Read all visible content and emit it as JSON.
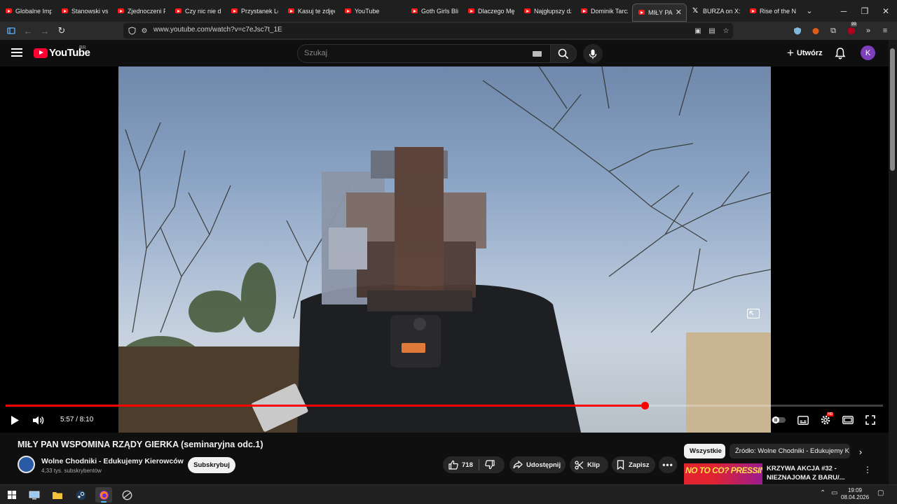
{
  "browser": {
    "tabs": [
      {
        "label": "Globalne Impe",
        "icon": "youtube-icon"
      },
      {
        "label": "Stanowski vs W",
        "icon": "youtube-icon"
      },
      {
        "label": "Zjednoczeni Pr",
        "icon": "youtube-icon"
      },
      {
        "label": "Czy nic nie dzi",
        "icon": "youtube-icon"
      },
      {
        "label": "Przystanek Lor",
        "icon": "youtube-icon"
      },
      {
        "label": "Kasuj te zdjęci",
        "icon": "youtube-icon"
      },
      {
        "label": "YouTube",
        "icon": "youtube-icon"
      },
      {
        "label": "Goth Girls Blin",
        "icon": "youtube-icon"
      },
      {
        "label": "Dlaczego Męsk",
        "icon": "youtube-icon"
      },
      {
        "label": "Najgłupszy dz",
        "icon": "youtube-icon"
      },
      {
        "label": "Dominik Tarczy",
        "icon": "youtube-icon"
      },
      {
        "label": "MIŁY PAN W",
        "icon": "youtube-icon",
        "active": true
      },
      {
        "label": "BURZA on X: \"",
        "icon": "x-icon"
      },
      {
        "label": "Rise of the Naz",
        "icon": "youtube-icon"
      }
    ],
    "url": "www.youtube.com/watch?v=c7eJsc7t_1E",
    "extension_badge": "99"
  },
  "masthead": {
    "logo_text": "YouTube",
    "country_code": "BR",
    "search_placeholder": "Szukaj",
    "create_label": "Utwórz",
    "avatar_letter": "K"
  },
  "player": {
    "current_time": "5:57",
    "duration": "8:10",
    "time_display": "5:57 / 8:10",
    "played_fraction": 0.7286,
    "hd_badge": "HD"
  },
  "video": {
    "title": "MIŁY PAN WSPOMINA RZĄDY GIERKA (seminaryjna odc.1)",
    "channel": "Wolne Chodniki - Edukujemy Kierowców",
    "subscribers": "4,33 tys. subskrybentów",
    "subscribe_label": "Subskrybuj",
    "likes": "718",
    "share_label": "Udostępnij",
    "clip_label": "Klip",
    "save_label": "Zapisz"
  },
  "sidebar": {
    "chips": [
      "Wszystkie",
      "Źródło: Wolne Chodniki - Edukujemy K"
    ],
    "recommended": {
      "title": "KRZYWA AKCJA #32 - NIEZNAJOMA Z BARU/...",
      "thumb_text": "NO TO CO?   PRESSING!"
    }
  },
  "taskbar": {
    "time": "19:09",
    "date": "08.04.2026"
  },
  "colors": {
    "youtube_red": "#ff0000",
    "background": "#0f0f0f",
    "avatar_purple": "#7e3fbd"
  }
}
